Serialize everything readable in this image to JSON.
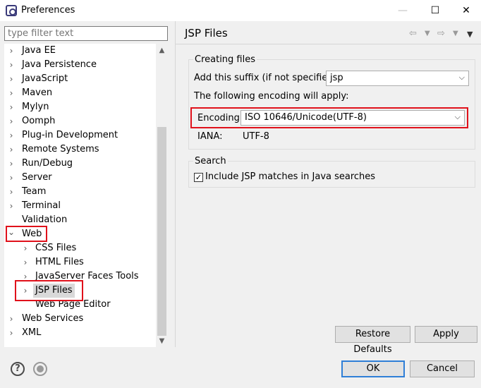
{
  "window": {
    "title": "Preferences",
    "minimize": "—",
    "maximize": "☐",
    "close": "✕"
  },
  "filter": {
    "placeholder": "type filter text"
  },
  "tree": [
    {
      "label": "Java EE",
      "arrow": "›"
    },
    {
      "label": "Java Persistence",
      "arrow": "›"
    },
    {
      "label": "JavaScript",
      "arrow": "›"
    },
    {
      "label": "Maven",
      "arrow": "›"
    },
    {
      "label": "Mylyn",
      "arrow": "›"
    },
    {
      "label": "Oomph",
      "arrow": "›"
    },
    {
      "label": "Plug-in Development",
      "arrow": "›"
    },
    {
      "label": "Remote Systems",
      "arrow": "›"
    },
    {
      "label": "Run/Debug",
      "arrow": "›"
    },
    {
      "label": "Server",
      "arrow": "›"
    },
    {
      "label": "Team",
      "arrow": "›"
    },
    {
      "label": "Terminal",
      "arrow": "›"
    },
    {
      "label": "Validation",
      "arrow": ""
    },
    {
      "label": "Web",
      "arrow": "⌄"
    },
    {
      "label": "CSS Files",
      "arrow": "›"
    },
    {
      "label": "HTML Files",
      "arrow": "›"
    },
    {
      "label": "JavaServer Faces Tools",
      "arrow": "›"
    },
    {
      "label": "JSP Files",
      "arrow": "›"
    },
    {
      "label": "Web Page Editor",
      "arrow": ""
    },
    {
      "label": "Web Services",
      "arrow": "›"
    },
    {
      "label": "XML",
      "arrow": "›"
    }
  ],
  "page": {
    "title": "JSP Files",
    "creating_files": {
      "title": "Creating files",
      "suffix_label": "Add this suffix (if not specified):",
      "suffix_value": "jsp",
      "encoding_note": "The following encoding will apply:",
      "encoding_label": "Encoding:",
      "encoding_value": "ISO 10646/Unicode(UTF-8)",
      "iana_label": "IANA:",
      "iana_value": "UTF-8"
    },
    "search": {
      "title": "Search",
      "include_label": "Include JSP matches in Java searches",
      "include_checked": true
    },
    "restore_defaults": "Restore Defaults",
    "apply": "Apply"
  },
  "footer": {
    "ok": "OK",
    "cancel": "Cancel",
    "help": "?"
  },
  "colors": {
    "highlight": "#e0111b",
    "default_button_border": "#2f7fd7"
  }
}
